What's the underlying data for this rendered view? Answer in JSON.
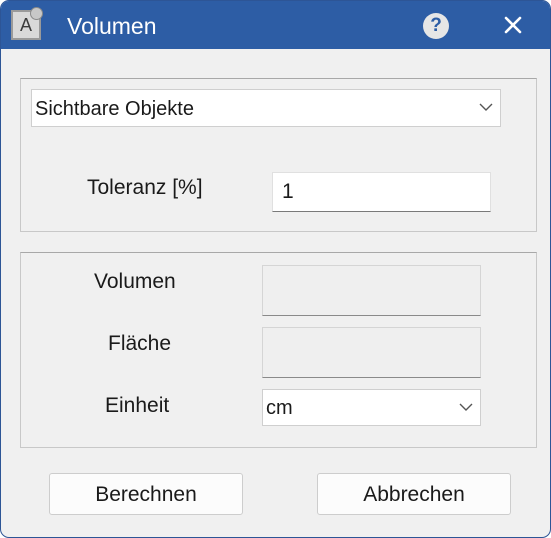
{
  "window": {
    "title": "Volumen",
    "app_icon_letter": "A",
    "help_label": "?"
  },
  "selection": {
    "objects_value": "Sichtbare Objekte",
    "tolerance_label": "Toleranz [%]",
    "tolerance_value": "1"
  },
  "results": {
    "volume_label": "Volumen",
    "volume_value": "",
    "area_label": "Fläche",
    "area_value": "",
    "unit_label": "Einheit",
    "unit_value": "cm"
  },
  "buttons": {
    "calculate_label": "Berechnen",
    "cancel_label": "Abbrechen"
  },
  "colors": {
    "titlebar": "#2d5da5",
    "dialog_background": "#f0f0f0"
  },
  "icons": {
    "app": "app-icon",
    "help": "help-icon",
    "close": "close-icon",
    "dropdown": "chevron-down-icon"
  }
}
